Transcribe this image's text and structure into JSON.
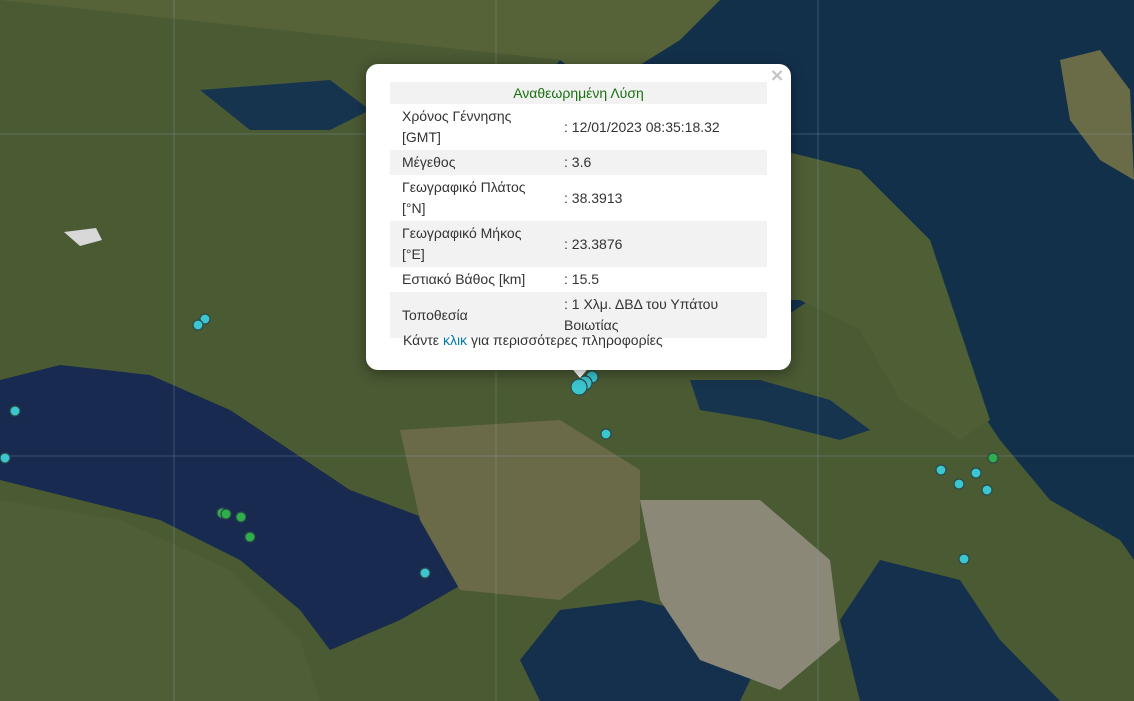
{
  "popup": {
    "close_label": "×",
    "header": "Αναθεωρημένη Λύση",
    "rows": [
      {
        "label": "Χρόνος Γέννησης [GMT]",
        "value": ": 12/01/2023 08:35:18.32"
      },
      {
        "label": "Μέγεθος",
        "value": ": 3.6"
      },
      {
        "label": "Γεωγραφικό Πλάτος [°N]",
        "value": ": 38.3913"
      },
      {
        "label": "Γεωγραφικό Μήκος [°E]",
        "value": ": 23.3876"
      },
      {
        "label": "Εστιακό Βάθος [km]",
        "value": ": 15.5"
      },
      {
        "label": "Τοποθεσία",
        "value": ": 1 Χλμ. ΔΒΔ του Υπάτου Βοιωτίας"
      }
    ],
    "more_prefix": "Κάντε",
    "more_link": "κλικ",
    "more_suffix": "για περισσότερες πληροφορίες"
  },
  "colors": {
    "marker_cyan": "#3cc6cf",
    "marker_green": "#2fae4c",
    "header_green": "#19710f",
    "link": "#0078a8"
  }
}
